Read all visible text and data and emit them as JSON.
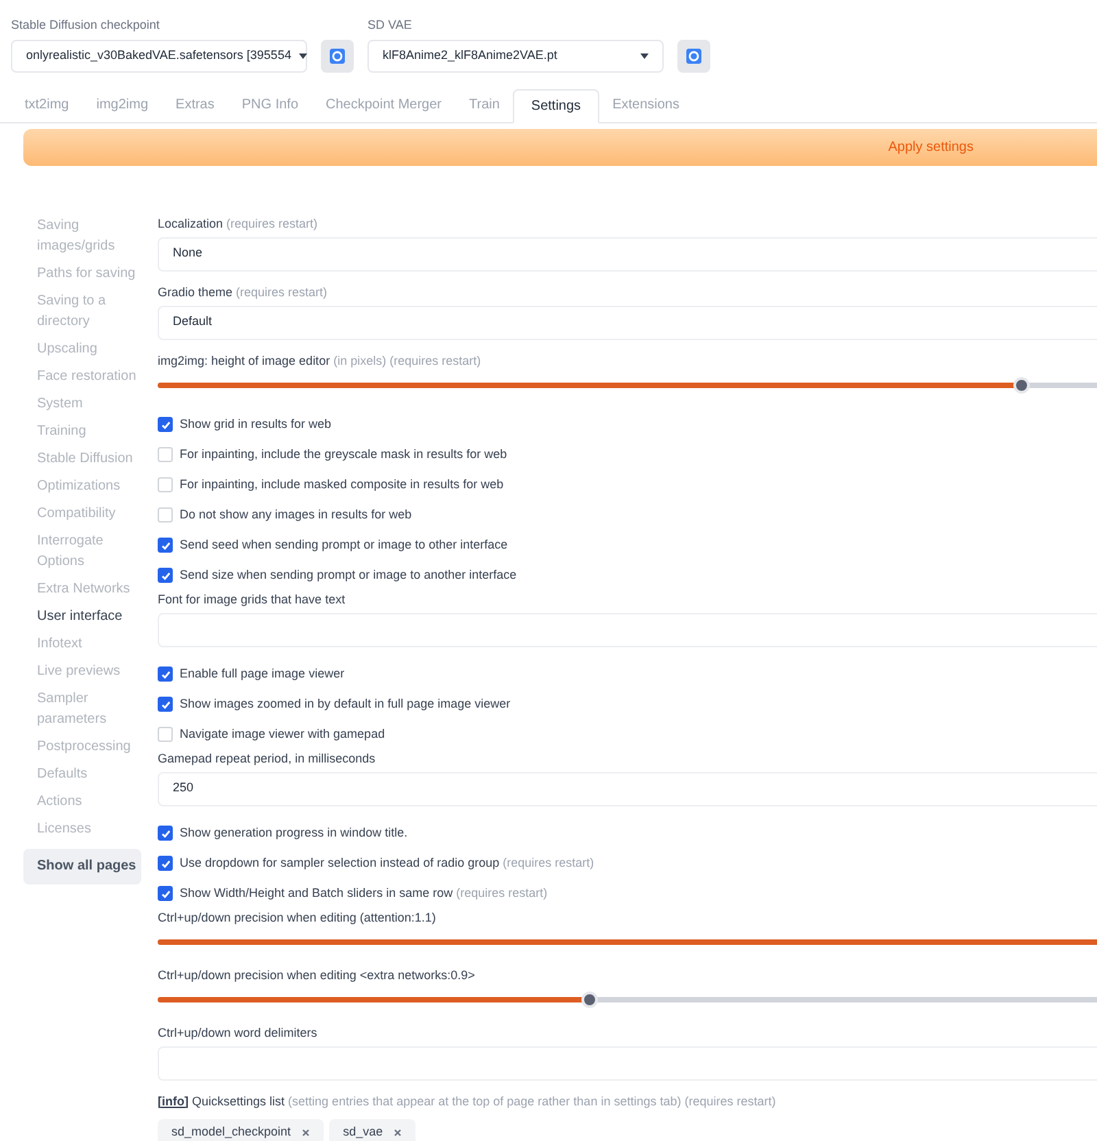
{
  "top_selects": [
    {
      "label": "Stable Diffusion checkpoint",
      "value": "onlyrealistic_v30BakedVAE.safetensors [395554"
    },
    {
      "label": "SD VAE",
      "value": "klF8Anime2_klF8Anime2VAE.pt"
    }
  ],
  "tabs": [
    {
      "label": "txt2img",
      "selected": false
    },
    {
      "label": "img2img",
      "selected": false
    },
    {
      "label": "Extras",
      "selected": false
    },
    {
      "label": "PNG Info",
      "selected": false
    },
    {
      "label": "Checkpoint Merger",
      "selected": false
    },
    {
      "label": "Train",
      "selected": false
    },
    {
      "label": "Settings",
      "selected": true
    },
    {
      "label": "Extensions",
      "selected": false
    }
  ],
  "apply_button": "Apply settings",
  "sidebar": {
    "items": [
      {
        "label": "Saving images/grids",
        "selected": false
      },
      {
        "label": "Paths for saving",
        "selected": false
      },
      {
        "label": "Saving to a directory",
        "selected": false
      },
      {
        "label": "Upscaling",
        "selected": false
      },
      {
        "label": "Face restoration",
        "selected": false
      },
      {
        "label": "System",
        "selected": false
      },
      {
        "label": "Training",
        "selected": false
      },
      {
        "label": "Stable Diffusion",
        "selected": false
      },
      {
        "label": "Optimizations",
        "selected": false
      },
      {
        "label": "Compatibility",
        "selected": false
      },
      {
        "label": "Interrogate Options",
        "selected": false
      },
      {
        "label": "Extra Networks",
        "selected": false
      },
      {
        "label": "User interface",
        "selected": true
      },
      {
        "label": "Infotext",
        "selected": false
      },
      {
        "label": "Live previews",
        "selected": false
      },
      {
        "label": "Sampler parameters",
        "selected": false
      },
      {
        "label": "Postprocessing",
        "selected": false
      },
      {
        "label": "Defaults",
        "selected": false
      },
      {
        "label": "Actions",
        "selected": false
      },
      {
        "label": "Licenses",
        "selected": false
      }
    ],
    "show_all": "Show all pages"
  },
  "settings": [
    {
      "kind": "dropdown",
      "label": "Localization",
      "note": "(requires restart)",
      "value": "None"
    },
    {
      "kind": "dropdown",
      "label": "Gradio theme",
      "note": "(requires restart)",
      "value": "Default"
    },
    {
      "kind": "slider",
      "label": "img2img: height of image editor",
      "note": "(in pixels) (requires restart)",
      "level": 0.9
    },
    {
      "kind": "checkbox",
      "label": "Show grid in results for web",
      "checked": true
    },
    {
      "kind": "checkbox",
      "label": "For inpainting, include the greyscale mask in results for web",
      "checked": false
    },
    {
      "kind": "checkbox",
      "label": "For inpainting, include masked composite in results for web",
      "checked": false
    },
    {
      "kind": "checkbox",
      "label": "Do not show any images in results for web",
      "checked": false
    },
    {
      "kind": "checkbox",
      "label": "Send seed when sending prompt or image to other interface",
      "checked": true
    },
    {
      "kind": "checkbox",
      "label": "Send size when sending prompt or image to another interface",
      "checked": true
    },
    {
      "kind": "text",
      "label": "Font for image grids that have text"
    },
    {
      "kind": "checkbox",
      "label": "Enable full page image viewer",
      "checked": true
    },
    {
      "kind": "checkbox",
      "label": "Show images zoomed in by default in full page image viewer",
      "checked": true
    },
    {
      "kind": "checkbox",
      "label": "Navigate image viewer with gamepad",
      "checked": false
    },
    {
      "kind": "text",
      "label": "Gamepad repeat period, in milliseconds",
      "value": "250"
    },
    {
      "kind": "checkbox",
      "label": "Show generation progress in window title.",
      "checked": true
    },
    {
      "kind": "checkbox",
      "label": "Use dropdown for sampler selection instead of radio group",
      "note": "(requires restart)",
      "checked": true
    },
    {
      "kind": "checkbox",
      "label": "Show Width/Height and Batch sliders in same row",
      "note": "(requires restart)",
      "checked": true
    },
    {
      "kind": "slider",
      "label": "Ctrl+up/down precision when editing (attention:1.1)",
      "level": 1
    },
    {
      "kind": "slider",
      "label": "Ctrl+up/down precision when editing <extra networks:0.9>",
      "level": 0.45
    },
    {
      "kind": "text",
      "label": "Ctrl+up/down word delimiters"
    },
    {
      "kind": "tags",
      "info": "[info]",
      "label": "Quicksettings list",
      "note": "(setting entries that appear at the top of page rather than in settings tab) (requires restart)",
      "tags": [
        "sd_model_checkpoint",
        "sd_vae"
      ]
    }
  ]
}
